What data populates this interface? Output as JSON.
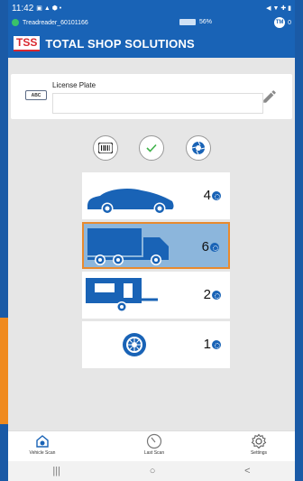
{
  "status_bar": {
    "time": "11:42",
    "indicators_left": "▣ ▲ ⬢ •",
    "indicators_right": "◀ ▼ ✚ ▮"
  },
  "device_bar": {
    "device_name": "Treadreader_60101166",
    "battery_percent": "56%",
    "badge": "TM",
    "badge_count": "0"
  },
  "header": {
    "logo": "TSS",
    "title": "TOTAL SHOP SOLUTIONS"
  },
  "license_plate": {
    "label": "License Plate",
    "icon_text": "ABC",
    "value": ""
  },
  "scan_actions": [
    {
      "name": "barcode-scan",
      "icon": "barcode-icon"
    },
    {
      "name": "confirm",
      "icon": "check-icon"
    },
    {
      "name": "camera",
      "icon": "camera-shutter-icon"
    }
  ],
  "vehicles": [
    {
      "type": "car",
      "tire_count": "4",
      "selected": false
    },
    {
      "type": "truck",
      "tire_count": "6",
      "selected": true
    },
    {
      "type": "trailer",
      "tire_count": "2",
      "selected": false
    },
    {
      "type": "single-tire",
      "tire_count": "1",
      "selected": false
    }
  ],
  "bottom_nav": {
    "vehicle_scan": "Vehicle Scan",
    "last_scan": "Last Scan",
    "settings": "Settings"
  },
  "android_nav": {
    "recents": "|||",
    "home": "○",
    "back": "<"
  },
  "colors": {
    "brand_blue": "#1963b6",
    "selection_orange": "#e88a2e",
    "selection_fill": "#8cb6dc",
    "brand_red": "#d9282f"
  }
}
